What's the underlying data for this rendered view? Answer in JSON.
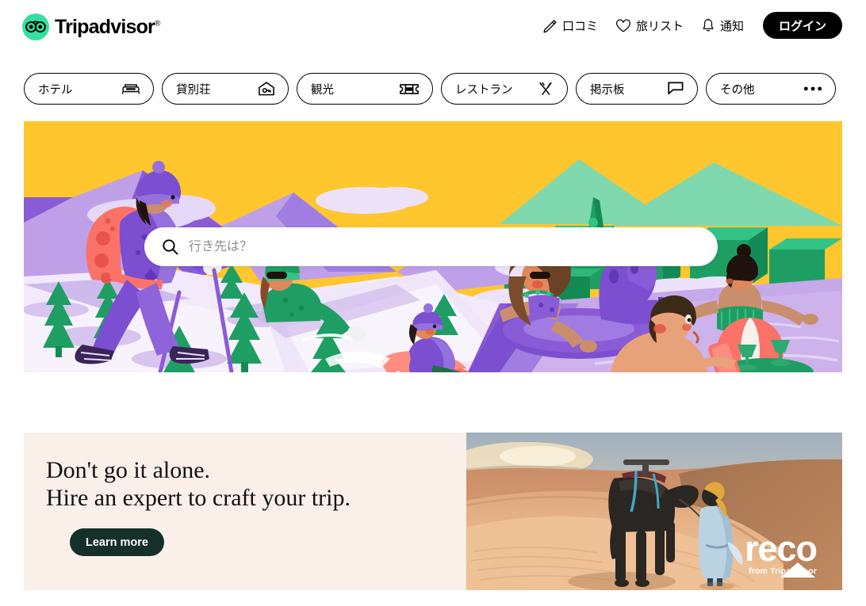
{
  "brand": {
    "name": "Tripadvisor",
    "trademark": "®",
    "owl_icon": "tripadvisor-owl-icon",
    "green": "#34E0A1"
  },
  "header": {
    "nav": [
      {
        "label": "口コミ",
        "icon": "pencil-icon"
      },
      {
        "label": "旅リスト",
        "icon": "heart-icon"
      },
      {
        "label": "通知",
        "icon": "bell-icon"
      }
    ],
    "login_label": "ログイン"
  },
  "tabs": [
    {
      "label": "ホテル",
      "icon": "bed-icon"
    },
    {
      "label": "貸別荘",
      "icon": "house-key-icon"
    },
    {
      "label": "観光",
      "icon": "ticket-icon"
    },
    {
      "label": "レストラン",
      "icon": "fork-knife-icon"
    },
    {
      "label": "掲示板",
      "icon": "speech-bubble-icon"
    },
    {
      "label": "その他",
      "icon": "ellipsis-icon"
    }
  ],
  "hero": {
    "alt": "winter-and-pool-travel-illustration",
    "sky_color": "#FFC62E",
    "mountain_color": "#8A5BD6",
    "snow_color": "#EADCF7",
    "tree_color": "#1F9E63",
    "water_color": "#C6A9E8"
  },
  "search": {
    "placeholder": "行き先は？",
    "value": "",
    "icon": "search-icon"
  },
  "promo": {
    "headline_line1": "Don't go it alone.",
    "headline_line2": "Hire an expert to craft your trip.",
    "cta_label": "Learn more",
    "cta_color": "#153029",
    "background": "#FAEFE9",
    "image_alt": "camel-and-guide-walking-desert-dunes-at-sunset",
    "logo_word": "reco",
    "logo_sub": "from Tripadvisor"
  }
}
